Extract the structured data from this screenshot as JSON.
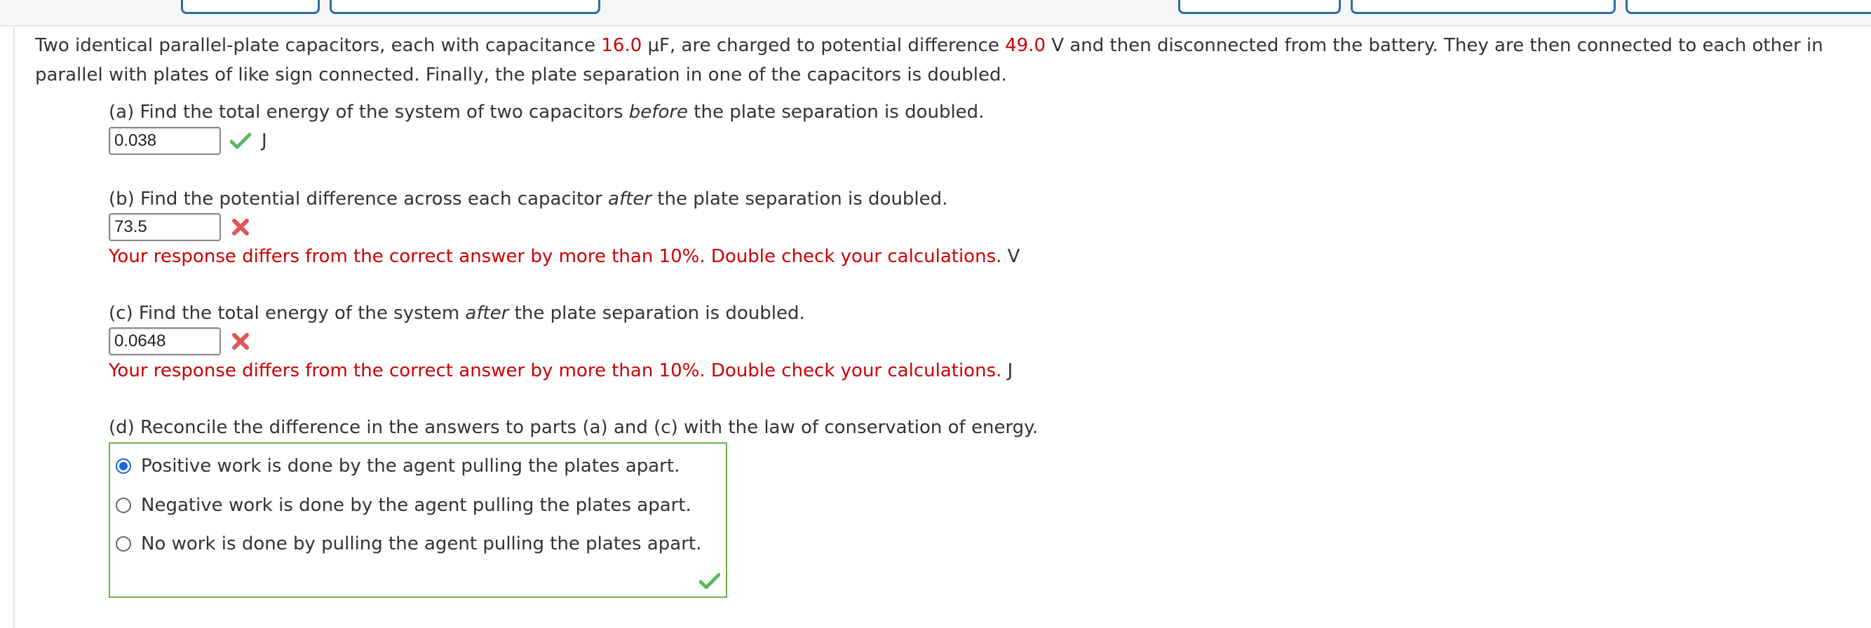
{
  "problem": {
    "text_1": "Two identical parallel-plate capacitors, each with capacitance ",
    "capacitance_value": "16.0",
    "text_2": " μF, are charged to potential difference ",
    "voltage_value": "49.0",
    "text_3": " V and then disconnected from the battery. They are then connected to each other in parallel with plates of like sign connected. Finally, the plate separation in one of the capacitors is doubled."
  },
  "parts": {
    "a": {
      "pre": "(a) Find the total energy of the system of two capacitors ",
      "em": "before",
      "post": " the plate separation is doubled.",
      "answer": "0.038",
      "unit": "J",
      "status": "correct"
    },
    "b": {
      "pre": "(b) Find the potential difference across each capacitor ",
      "em": "after",
      "post": " the plate separation is doubled.",
      "answer": "73.5",
      "feedback": "Your response differs from the correct answer by more than 10%. Double check your calculations.",
      "unit": "V",
      "status": "incorrect"
    },
    "c": {
      "pre": "(c) Find the total energy of the system ",
      "em": "after",
      "post": " the plate separation is doubled.",
      "answer": "0.0648",
      "feedback": "Your response differs from the correct answer by more than 10%. Double check your calculations.",
      "unit": "J",
      "status": "incorrect"
    },
    "d": {
      "question": "(d) Reconcile the difference in the answers to parts (a) and (c) with the law of conservation of energy.",
      "options": [
        "Positive work is done by the agent pulling the plates apart.",
        "Negative work is done by the agent pulling the plates apart.",
        "No work is done by pulling the agent pulling the plates apart."
      ],
      "selected_index": 0,
      "status": "correct"
    }
  },
  "colors": {
    "highlight_red": "#cc0000",
    "correct_green": "#5cb85c",
    "incorrect_red": "#e05555",
    "radio_blue": "#1a66d9",
    "button_border": "#2a6ea6"
  }
}
